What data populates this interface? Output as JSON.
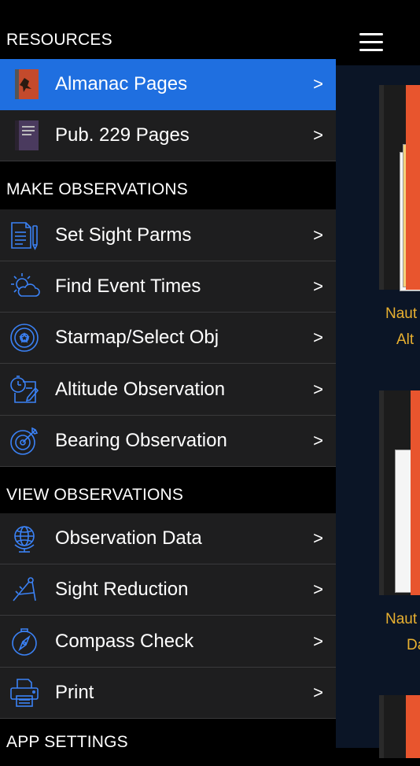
{
  "sections": {
    "resources": "RESOURCES",
    "make_observations": "MAKE OBSERVATIONS",
    "view_observations": "VIEW OBSERVATIONS",
    "app_settings": "APP SETTINGS"
  },
  "items": {
    "almanac": {
      "label": "Almanac Pages",
      "chevron": ">",
      "icon": "almanac-book-icon"
    },
    "pub229": {
      "label": "Pub. 229 Pages",
      "chevron": ">",
      "icon": "pub229-book-icon"
    },
    "sight_parms": {
      "label": "Set Sight Parms",
      "chevron": ">",
      "icon": "document-pen-icon"
    },
    "event_times": {
      "label": "Find Event Times",
      "chevron": ">",
      "icon": "sun-cloud-icon"
    },
    "starmap": {
      "label": "Starmap/Select Obj",
      "chevron": ">",
      "icon": "starmap-icon"
    },
    "altitude": {
      "label": "Altitude Observation",
      "chevron": ">",
      "icon": "stopwatch-notepad-icon"
    },
    "bearing": {
      "label": "Bearing Observation",
      "chevron": ">",
      "icon": "target-arrow-icon"
    },
    "obs_data": {
      "label": "Observation Data",
      "chevron": ">",
      "icon": "globe-icon"
    },
    "sight_reduction": {
      "label": "Sight Reduction",
      "chevron": ">",
      "icon": "compass-divider-icon"
    },
    "compass_check": {
      "label": "Compass Check",
      "chevron": ">",
      "icon": "compass-icon"
    },
    "print": {
      "label": "Print",
      "chevron": ">",
      "icon": "printer-icon"
    }
  },
  "content": {
    "book1_caption_line1": "Naut",
    "book1_caption_line2": "Alt",
    "book2_caption_line1": "Naut",
    "book2_caption_line2": "Da"
  },
  "colors": {
    "accent": "#1f6fe0",
    "icon_blue": "#3b82f6",
    "caption": "#e8b030"
  }
}
